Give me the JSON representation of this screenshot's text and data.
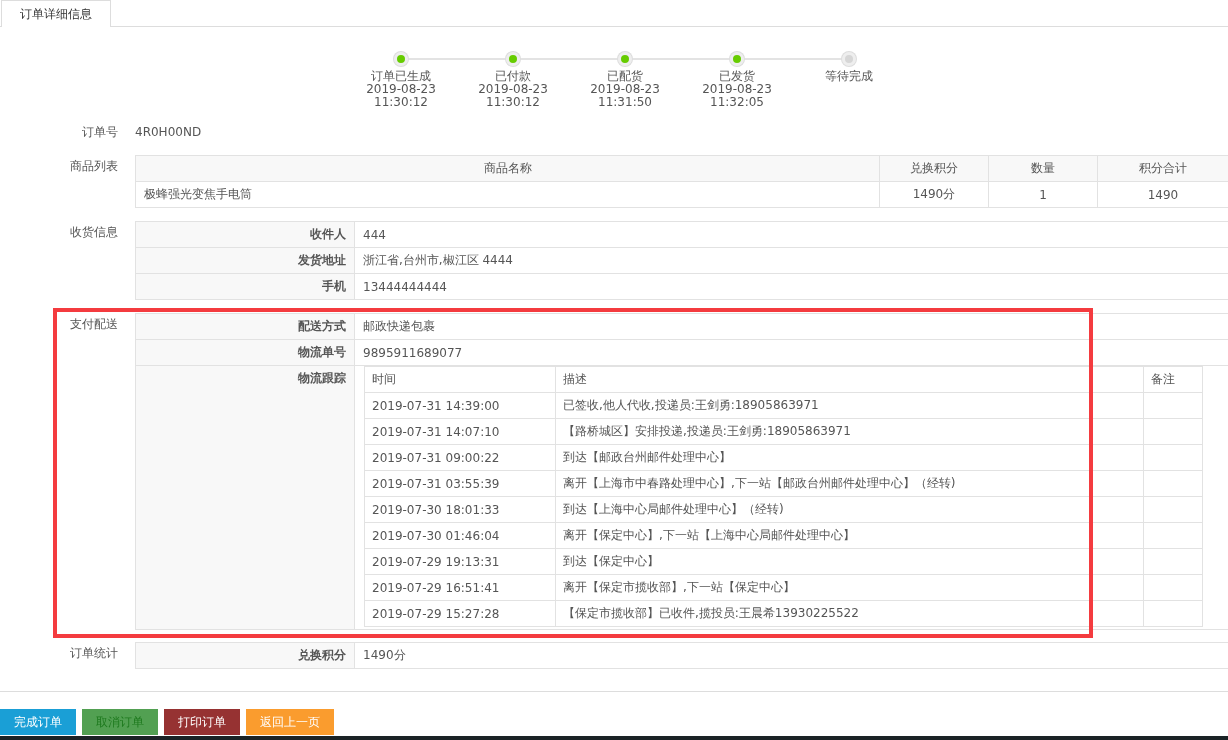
{
  "tabs": [
    {
      "label": "订单详细信息",
      "selected": true
    }
  ],
  "steps": [
    {
      "label": "订单已生成",
      "date": "2019-08-23",
      "time": "11:30:12",
      "done": true
    },
    {
      "label": "已付款",
      "date": "2019-08-23",
      "time": "11:30:12",
      "done": true
    },
    {
      "label": "已配货",
      "date": "2019-08-23",
      "time": "11:31:50",
      "done": true
    },
    {
      "label": "已发货",
      "date": "2019-08-23",
      "time": "11:32:05",
      "done": true
    },
    {
      "label": "等待完成",
      "done": false
    }
  ],
  "order_number": {
    "label": "订单号",
    "value": "4R0H00ND"
  },
  "goods": {
    "label": "商品列表",
    "columns": [
      "商品名称",
      "兑换积分",
      "数量",
      "积分合计"
    ],
    "rows": [
      [
        "极蜂强光变焦手电筒",
        "1490分",
        "1",
        "1490"
      ]
    ]
  },
  "receiving": {
    "label": "收货信息",
    "fields": [
      {
        "label": "收件人",
        "value": "444"
      },
      {
        "label": "发货地址",
        "value": "浙江省,台州市,椒江区 4444"
      },
      {
        "label": "手机",
        "value": "13444444444"
      }
    ]
  },
  "delivery": {
    "label": "支付配送",
    "highlighted": true,
    "fields": [
      {
        "label": "配送方式",
        "value": "邮政快递包裹"
      },
      {
        "label": "物流单号",
        "value": "9895911689077"
      }
    ],
    "tracking": {
      "label": "物流跟踪",
      "columns": [
        "时间",
        "描述",
        "备注"
      ],
      "rows": [
        [
          "2019-07-31 14:39:00",
          "已签收,他人代收,投递员:王剑勇:18905863971"
        ],
        [
          "2019-07-31 14:07:10",
          "【路桥城区】安排投递,投递员:王剑勇:18905863971"
        ],
        [
          "2019-07-31 09:00:22",
          "到达【邮政台州邮件处理中心】"
        ],
        [
          "2019-07-31 03:55:39",
          "离开【上海市中春路处理中心】,下一站【邮政台州邮件处理中心】（经转)"
        ],
        [
          "2019-07-30 18:01:33",
          "到达【上海中心局邮件处理中心】（经转)"
        ],
        [
          "2019-07-30 01:46:04",
          "离开【保定中心】,下一站【上海中心局邮件处理中心】"
        ],
        [
          "2019-07-29 19:13:31",
          "到达【保定中心】"
        ],
        [
          "2019-07-29 16:51:41",
          "离开【保定市揽收部】,下一站【保定中心】"
        ],
        [
          "2019-07-29 15:27:28",
          "【保定市揽收部】已收件,揽投员:王晨希13930225522"
        ]
      ]
    }
  },
  "statistics": {
    "label": "订单统计",
    "fields": [
      {
        "label": "兑换积分",
        "value": "1490分"
      }
    ]
  },
  "buttons": [
    {
      "label": "完成订单",
      "kind": "complete"
    },
    {
      "label": "取消订单",
      "kind": "cancel"
    },
    {
      "label": "打印订单",
      "kind": "print"
    },
    {
      "label": "返回上一页",
      "kind": "back"
    }
  ]
}
